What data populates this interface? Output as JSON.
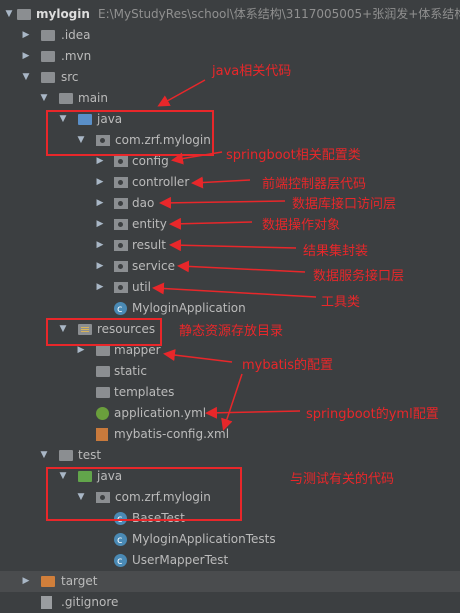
{
  "project": {
    "name": "mylogin",
    "path": "E:\\MyStudyRes\\school\\体系结构\\3117005005+张润发+体系结构"
  },
  "tree": {
    "idea": ".idea",
    "mvn": ".mvn",
    "src": "src",
    "main": "main",
    "java": "java",
    "package": "com.zrf.mylogin",
    "config": "config",
    "controller": "controller",
    "dao": "dao",
    "entity": "entity",
    "result": "result",
    "service": "service",
    "util": "util",
    "app_class": "MyloginApplication",
    "resources": "resources",
    "mapper": "mapper",
    "static": "static",
    "templates": "templates",
    "app_yml": "application.yml",
    "mybatis_config": "mybatis-config.xml",
    "test": "test",
    "test_java": "java",
    "test_package": "com.zrf.mylogin",
    "base_test": "BaseTest",
    "app_tests": "MyloginApplicationTests",
    "user_mapper_test": "UserMapperTest",
    "target": "target",
    "gitignore": ".gitignore"
  },
  "annotations": {
    "java": "java相关代码",
    "springboot": "springboot相关配置类",
    "controller": "前端控制器层代码",
    "dao": "数据库接口访问层",
    "entity": "数据操作对象",
    "result": "结果集封装",
    "service": "数据服务接口层",
    "util": "工具类",
    "resources": "静态资源存放目录",
    "mapper": "mybatis的配置",
    "yml": "springboot的yml配置",
    "test": "与测试有关的代码"
  },
  "colors": {
    "background": "#3c3f41",
    "annotation": "#e8272a",
    "text": "#bbbbbb"
  }
}
